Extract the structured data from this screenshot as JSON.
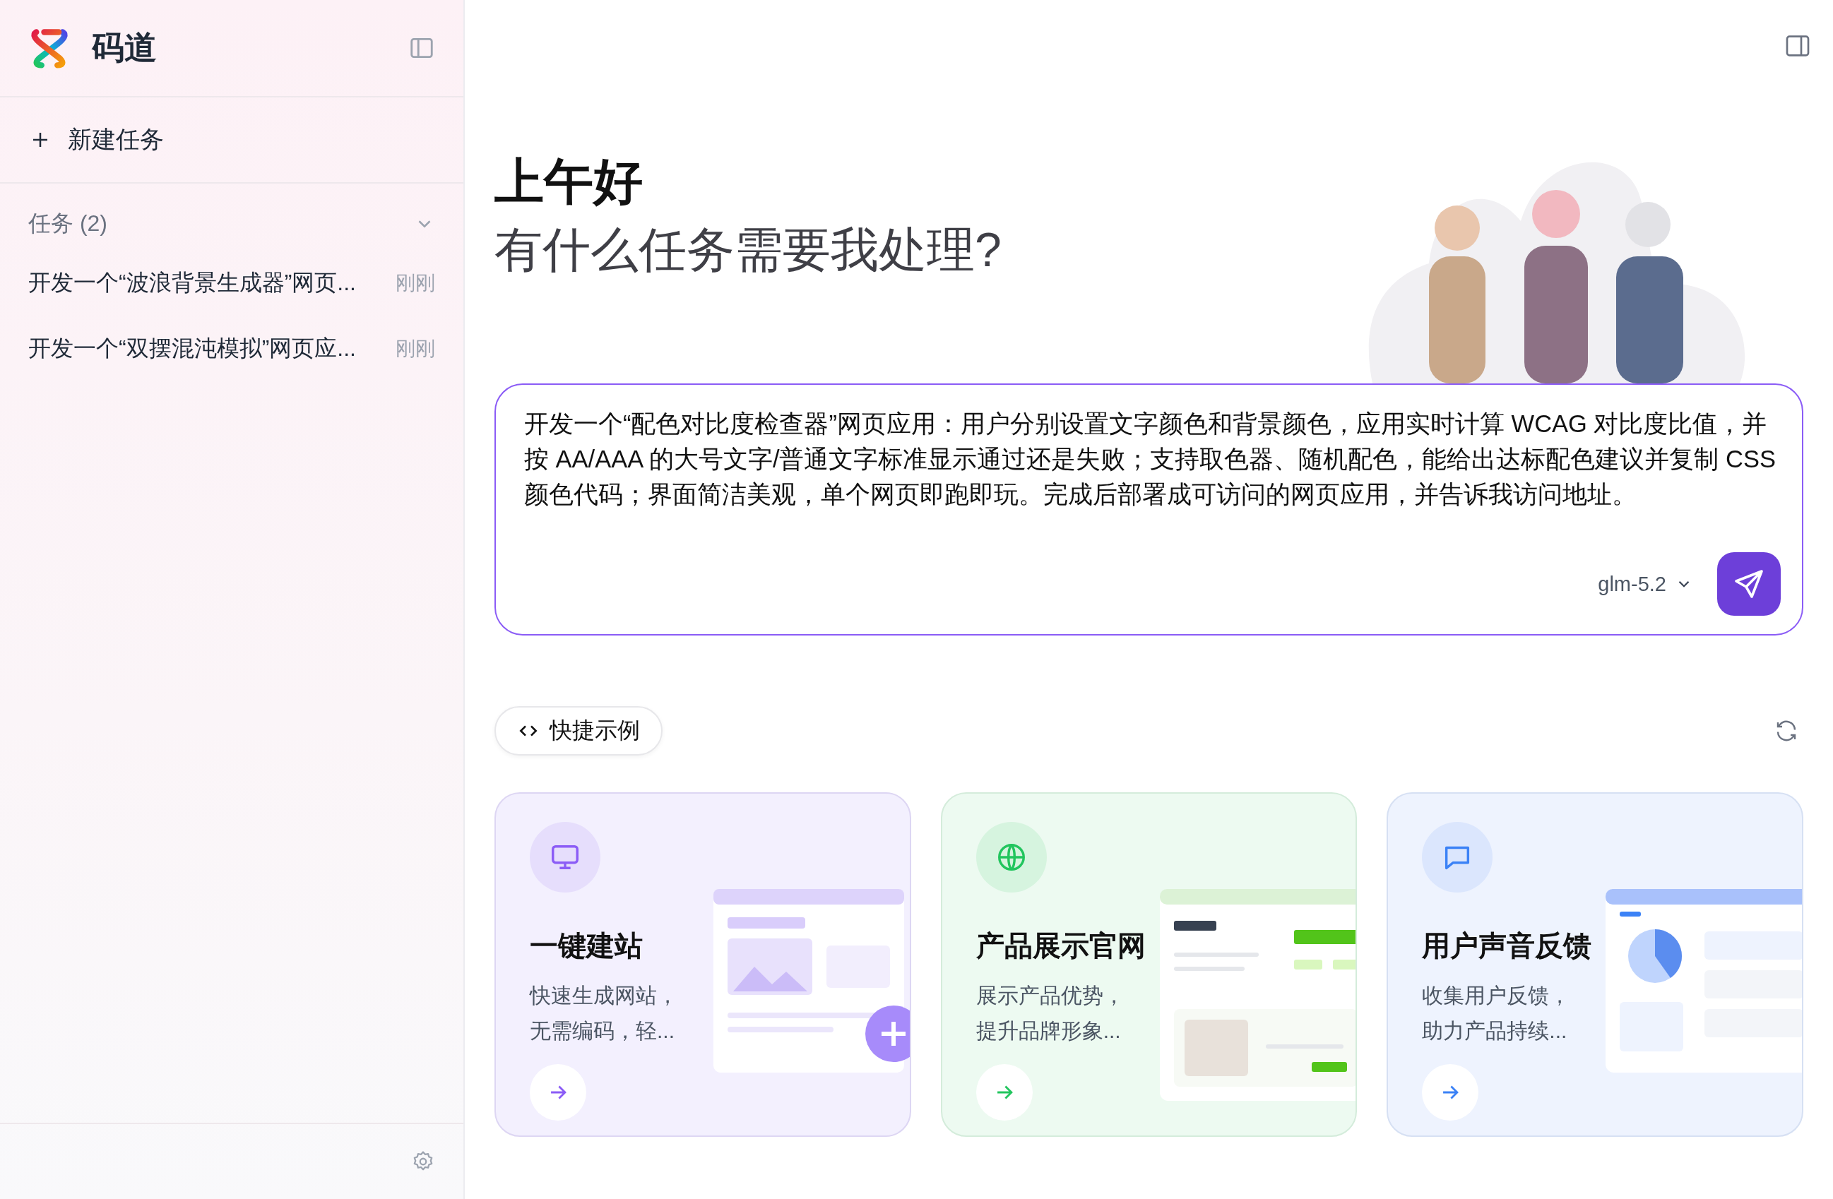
{
  "sidebar": {
    "brand": "码道",
    "new_task": "新建任务",
    "tasks_header": "任务 (2)",
    "tasks_expanded": true,
    "tasks": [
      {
        "title": "开发一个“波浪背景生成器”网页...",
        "time": "刚刚"
      },
      {
        "title": "开发一个“双摆混沌模拟”网页应...",
        "time": "刚刚"
      }
    ]
  },
  "main": {
    "greeting": "上午好",
    "subtitle": "有什么任务需要我处理?",
    "prompt": {
      "value": "开发一个“配色对比度检查器”网页应用：用户分别设置文字颜色和背景颜色，应用实时计算 WCAG 对比度比值，并按 AA/AAA 的大号文字/普通文字标准显示通过还是失败；支持取色器、随机配色，能给出达标配色建议并复制 CSS 颜色代码；界面简洁美观，单个网页即跑即玩。完成后部署成可访问的网页应用，并告诉我访问地址。",
      "model": "glm-5.2"
    },
    "quick_examples": {
      "label": "快捷示例",
      "cards": [
        {
          "kind": "site",
          "title": "一键建站",
          "desc_lines": [
            "快速生成网站，",
            "无需编码，轻..."
          ]
        },
        {
          "kind": "product",
          "title": "产品展示官网",
          "desc_lines": [
            "展示产品优势，",
            "提升品牌形象..."
          ]
        },
        {
          "kind": "feedback",
          "title": "用户声音反馈",
          "desc_lines": [
            "收集用户反馈，",
            "助力产品持续..."
          ]
        }
      ]
    }
  }
}
